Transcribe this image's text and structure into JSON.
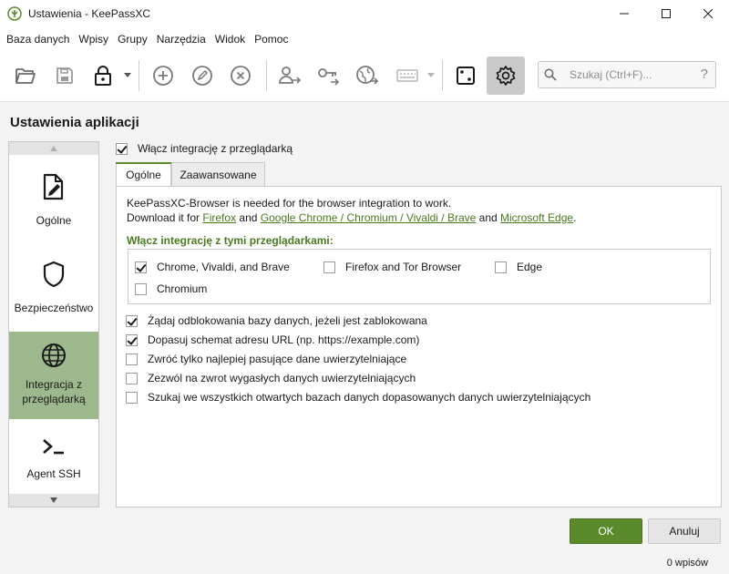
{
  "window": {
    "title": "Ustawienia - KeePassXC"
  },
  "menu": [
    "Baza danych",
    "Wpisy",
    "Grupy",
    "Narzędzia",
    "Widok",
    "Pomoc"
  ],
  "toolbar": {
    "icons": [
      "folder-open-icon",
      "save-icon",
      "lock-icon",
      "add-entry-icon",
      "edit-entry-icon",
      "delete-entry-icon",
      "copy-username-icon",
      "copy-password-icon",
      "open-url-icon",
      "auto-type-icon",
      "password-generator-icon",
      "settings-icon"
    ],
    "search_placeholder": "Szukaj (Ctrl+F)...",
    "help_glyph": "?"
  },
  "page_title": "Ustawienia aplikacji",
  "categories": [
    {
      "label": "Ogólne",
      "icon": "general-settings-icon",
      "selected": false
    },
    {
      "label": "Bezpieczeństwo",
      "icon": "shield-icon",
      "selected": false
    },
    {
      "label": "Integracja z przeglądarką",
      "icon": "globe-icon",
      "selected": true
    },
    {
      "label": "Agent SSH",
      "icon": "terminal-icon",
      "selected": false
    }
  ],
  "enable_browser": {
    "label": "Włącz integrację z przeglądarką",
    "checked": true
  },
  "tabs": [
    {
      "label": "Ogólne",
      "active": true
    },
    {
      "label": "Zaawansowane",
      "active": false
    }
  ],
  "info": {
    "line1": "KeePassXC-Browser is needed for the browser integration to work.",
    "line2_prefix": "Download it for ",
    "link_firefox": "Firefox",
    "and1": " and ",
    "link_chrome": "Google Chrome / Chromium / Vivaldi / Brave",
    "and2": " and ",
    "link_edge": "Microsoft Edge",
    "period": "."
  },
  "browsers_group": {
    "title": "Włącz integrację z tymi przeglądarkami:",
    "items": [
      {
        "label": "Chrome, Vivaldi, and Brave",
        "checked": true
      },
      {
        "label": "Firefox and Tor Browser",
        "checked": false
      },
      {
        "label": "Edge",
        "checked": false
      },
      {
        "label": "Chromium",
        "checked": false
      }
    ]
  },
  "options": [
    {
      "label": "Żądaj odblokowania bazy danych, jeżeli jest zablokowana",
      "checked": true
    },
    {
      "label": "Dopasuj schemat adresu URL (np. https://example.com)",
      "checked": true
    },
    {
      "label": "Zwróć tylko najlepiej pasujące dane uwierzytelniające",
      "checked": false
    },
    {
      "label": "Zezwól na zwrot wygasłych danych uwierzytelniających",
      "checked": false
    },
    {
      "label": "Szukaj we wszystkich otwartych bazach danych dopasowanych danych uwierzytelniających",
      "checked": false
    }
  ],
  "buttons": {
    "ok": "OK",
    "cancel": "Anuluj"
  },
  "status": "0 wpisów",
  "colors": {
    "accent": "#5a8a2a",
    "selected_category": "#9eb88e",
    "link": "#4a7a1f"
  }
}
